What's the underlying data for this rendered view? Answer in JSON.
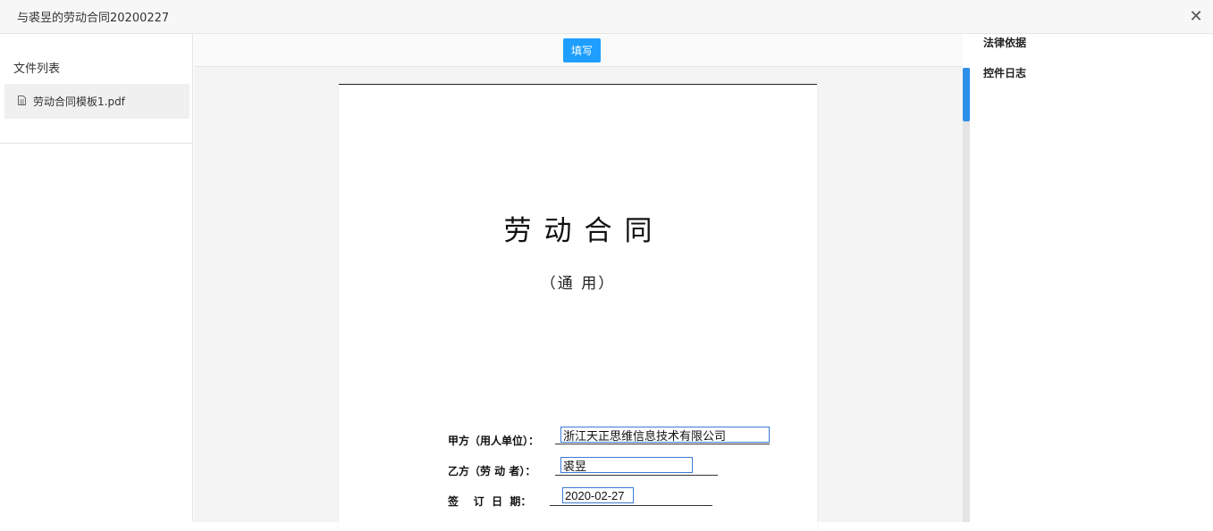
{
  "window": {
    "title": "与裘昱的劳动合同20200227",
    "close_icon": "close-icon"
  },
  "sidebar": {
    "heading": "文件列表",
    "files": [
      {
        "name": "劳动合同模板1.pdf",
        "icon": "document-icon"
      }
    ]
  },
  "toolbar": {
    "fill_label": "填写",
    "fill_color": "#1e9fff"
  },
  "document": {
    "title": "劳动合同",
    "subtitle": "（通 用）",
    "fields": {
      "party_a_label": "甲方（用人单位）：",
      "party_a_value": "浙江天正思维信息技术有限公司",
      "party_b_label": "乙方（劳 动 者）：",
      "party_b_value": "裘昱",
      "sign_date_label": "签    订  日  期：",
      "sign_date_value": "2020-02-27"
    }
  },
  "right_panel": {
    "tabs": [
      "法律依据",
      "控件日志"
    ]
  },
  "colors": {
    "accent": "#1e9fff",
    "field_border": "#3a7bd5",
    "scroll_thumb": "#2e8fe8"
  }
}
